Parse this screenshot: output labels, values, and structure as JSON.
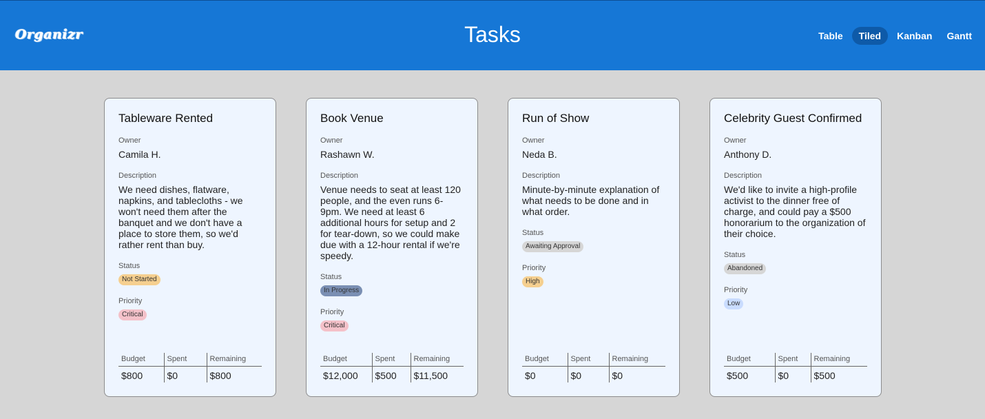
{
  "header": {
    "logo": "Organizr",
    "title": "Tasks",
    "views": [
      {
        "label": "Table",
        "active": false
      },
      {
        "label": "Tiled",
        "active": true
      },
      {
        "label": "Kanban",
        "active": false
      },
      {
        "label": "Gantt",
        "active": false
      }
    ],
    "color": "#1677d6"
  },
  "labels": {
    "owner": "Owner",
    "description": "Description",
    "status": "Status",
    "priority": "Priority",
    "budget": "Budget",
    "spent": "Spent",
    "remaining": "Remaining"
  },
  "tasks": [
    {
      "title": "Tableware Rented",
      "owner": "Camila H.",
      "description": "We need dishes, flatware, napkins, and tablecloths - we won't need them after the banquet and we don't have a place to store them, so we'd rather rent than buy.",
      "status": "Not Started",
      "status_color": "#f5cf8f",
      "priority": "Critical",
      "priority_color": "#f4c1c9",
      "budget": "$800",
      "spent": "$0",
      "remaining": "$800"
    },
    {
      "title": "Book Venue",
      "owner": "Rashawn W.",
      "description": "Venue needs to seat at least 120 people, and the even runs 6-9pm. We need at least 6 additional hours for setup and 2 for tear-down, so we could make due with a 12-hour rental if we're speedy.",
      "status": "In Progress",
      "status_color": "#7a8fb3",
      "priority": "Critical",
      "priority_color": "#f4c1c9",
      "budget": "$12,000",
      "spent": "$500",
      "remaining": "$11,500"
    },
    {
      "title": "Run of Show",
      "owner": "Neda B.",
      "description": "Minute-by-minute explanation of what needs to be done and in what order.",
      "status": "Awaiting Approval",
      "status_color": "#d6d6d6",
      "priority": "High",
      "priority_color": "#f5cf8f",
      "budget": "$0",
      "spent": "$0",
      "remaining": "$0"
    },
    {
      "title": "Celebrity Guest Confirmed",
      "owner": "Anthony D.",
      "description": "We'd like to invite a high-profile activist to the dinner free of charge, and could pay a $500 honorarium to the organization of their choice.",
      "status": "Abandoned",
      "status_color": "#d6d6d6",
      "priority": "Low",
      "priority_color": "#c9dcff",
      "budget": "$500",
      "spent": "$0",
      "remaining": "$500"
    }
  ]
}
